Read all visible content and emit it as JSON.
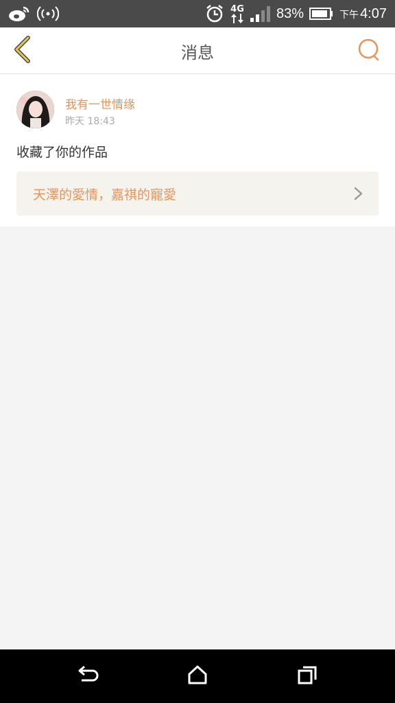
{
  "status_bar": {
    "network": "4G",
    "battery": "83%",
    "time_prefix": "下午",
    "time": "4:07",
    "icons": [
      "weibo-icon",
      "wifi-hotspot-icon",
      "alarm-icon",
      "signal-icon",
      "battery-icon"
    ]
  },
  "header": {
    "title": "消息",
    "back_icon": "chevron-left-icon",
    "search_icon": "search-icon"
  },
  "message": {
    "username": "我有一世情缘",
    "timestamp": "昨天 18:43",
    "action": "收藏了你的作品",
    "work_title": "天澤的愛情，嘉祺的寵愛"
  },
  "nav_bar": {
    "icons": [
      "back-icon",
      "home-icon",
      "recent-apps-icon"
    ]
  },
  "colors": {
    "accent": "#e8955a",
    "back_arrow": "#e8c84a",
    "status_bar_bg": "#4a4a4a",
    "page_bg": "#f4f4f4"
  }
}
